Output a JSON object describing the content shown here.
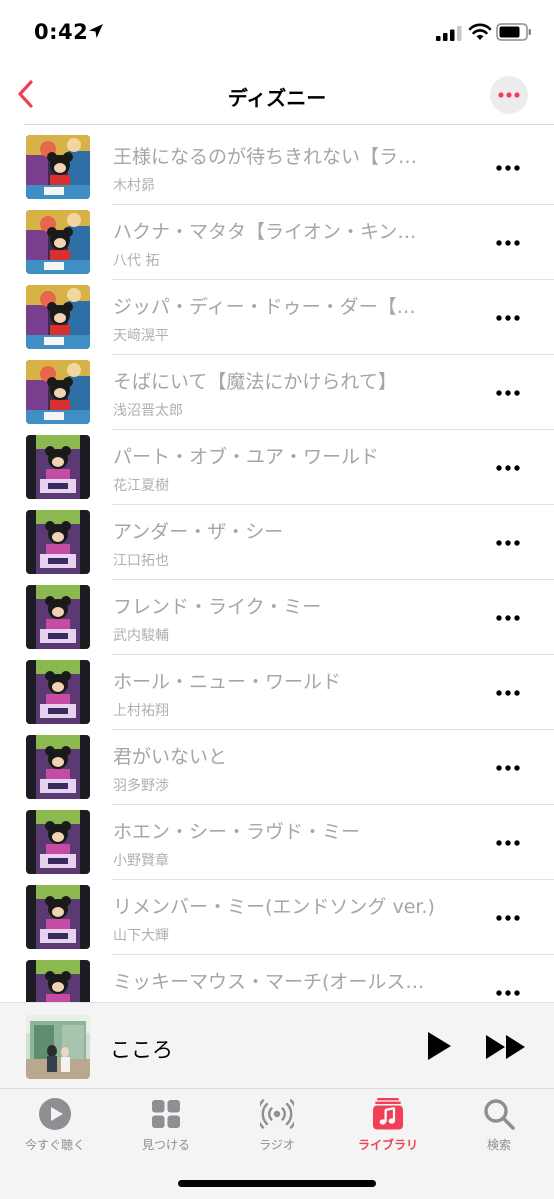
{
  "status_bar": {
    "time": "0:42",
    "location_icon": "location-arrow-icon",
    "signal_icon": "cellular-signal-icon",
    "wifi_icon": "wifi-icon",
    "battery_icon": "battery-icon"
  },
  "nav": {
    "title": "ディズニー",
    "back_icon": "chevron-left-icon",
    "more_icon": "ellipsis-icon"
  },
  "colors": {
    "accent": "#f03f56",
    "inactive": "#8e8e93",
    "song_text": "#a6a6a8"
  },
  "songs": [
    {
      "title": "王様になるのが待ちきれない【ラ…",
      "artist": "木村昴",
      "art": "album-a"
    },
    {
      "title": "ハクナ・マタタ【ライオン・キン…",
      "artist": "八代 拓",
      "art": "album-a"
    },
    {
      "title": "ジッパ・ディー・ドゥー・ダー【…",
      "artist": "天﨑滉平",
      "art": "album-a"
    },
    {
      "title": "そばにいて【魔法にかけられて】",
      "artist": "浅沼晋太郎",
      "art": "album-a"
    },
    {
      "title": "パート・オブ・ユア・ワールド",
      "artist": "花江夏樹",
      "art": "album-b"
    },
    {
      "title": "アンダー・ザ・シー",
      "artist": "江口拓也",
      "art": "album-b"
    },
    {
      "title": "フレンド・ライク・ミー",
      "artist": "武内駿輔",
      "art": "album-b"
    },
    {
      "title": "ホール・ニュー・ワールド",
      "artist": "上村祐翔",
      "art": "album-b"
    },
    {
      "title": "君がいないと",
      "artist": "羽多野渉",
      "art": "album-b"
    },
    {
      "title": "ホエン・シー・ラヴド・ミー",
      "artist": "小野賢章",
      "art": "album-b"
    },
    {
      "title": "リメンバー・ミー(エンドソング ver.)",
      "artist": "山下大輝",
      "art": "album-b"
    },
    {
      "title": "ミッキーマウス・マーチ(オールス…",
      "artist": "",
      "art": "album-b"
    }
  ],
  "now_playing": {
    "title": "こころ",
    "play_icon": "play-icon",
    "forward_icon": "fast-forward-icon"
  },
  "tabs": [
    {
      "label": "今すぐ聴く",
      "icon": "play-circle-icon",
      "active": false
    },
    {
      "label": "見つける",
      "icon": "grid-icon",
      "active": false
    },
    {
      "label": "ラジオ",
      "icon": "radio-waves-icon",
      "active": false
    },
    {
      "label": "ライブラリ",
      "icon": "music-library-icon",
      "active": true
    },
    {
      "label": "検索",
      "icon": "magnifier-icon",
      "active": false
    }
  ]
}
